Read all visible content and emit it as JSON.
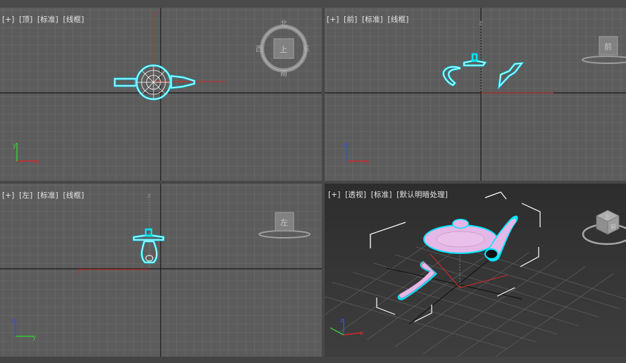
{
  "viewports": {
    "top": {
      "plus": "[+]",
      "view": "[顶]",
      "shading": "[标准]",
      "mode": "[线框]"
    },
    "front": {
      "plus": "[+]",
      "view": "[前]",
      "shading": "[标准]",
      "mode": "[线框]"
    },
    "left": {
      "plus": "[+]",
      "view": "[左]",
      "shading": "[标准]",
      "mode": "[线框]"
    },
    "persp": {
      "plus": "[+]",
      "view": "[透视]",
      "shading": "[标准]",
      "mode": "[默认明暗处理]"
    }
  },
  "viewcube": {
    "top": {
      "face": "上",
      "north": "北",
      "south": "南",
      "west": "西",
      "east": "东"
    },
    "front": {
      "face": "前"
    },
    "left": {
      "face": "左"
    },
    "persp": {
      "face_a": "上",
      "face_b": "前"
    }
  },
  "axes": {
    "x": "x",
    "y": "y",
    "z": "z"
  },
  "colors": {
    "grid_bg": "#5c5c5c",
    "grid_line": "#6b6b6b",
    "grid_major": "#141414",
    "selection_outline": "#00e5ff",
    "teapot_shaded": "#e5b7e6",
    "axis_x": "#d22a2a",
    "axis_y": "#3ac93a",
    "axis_z": "#3a4fd8",
    "active_border": "#b59a54"
  }
}
